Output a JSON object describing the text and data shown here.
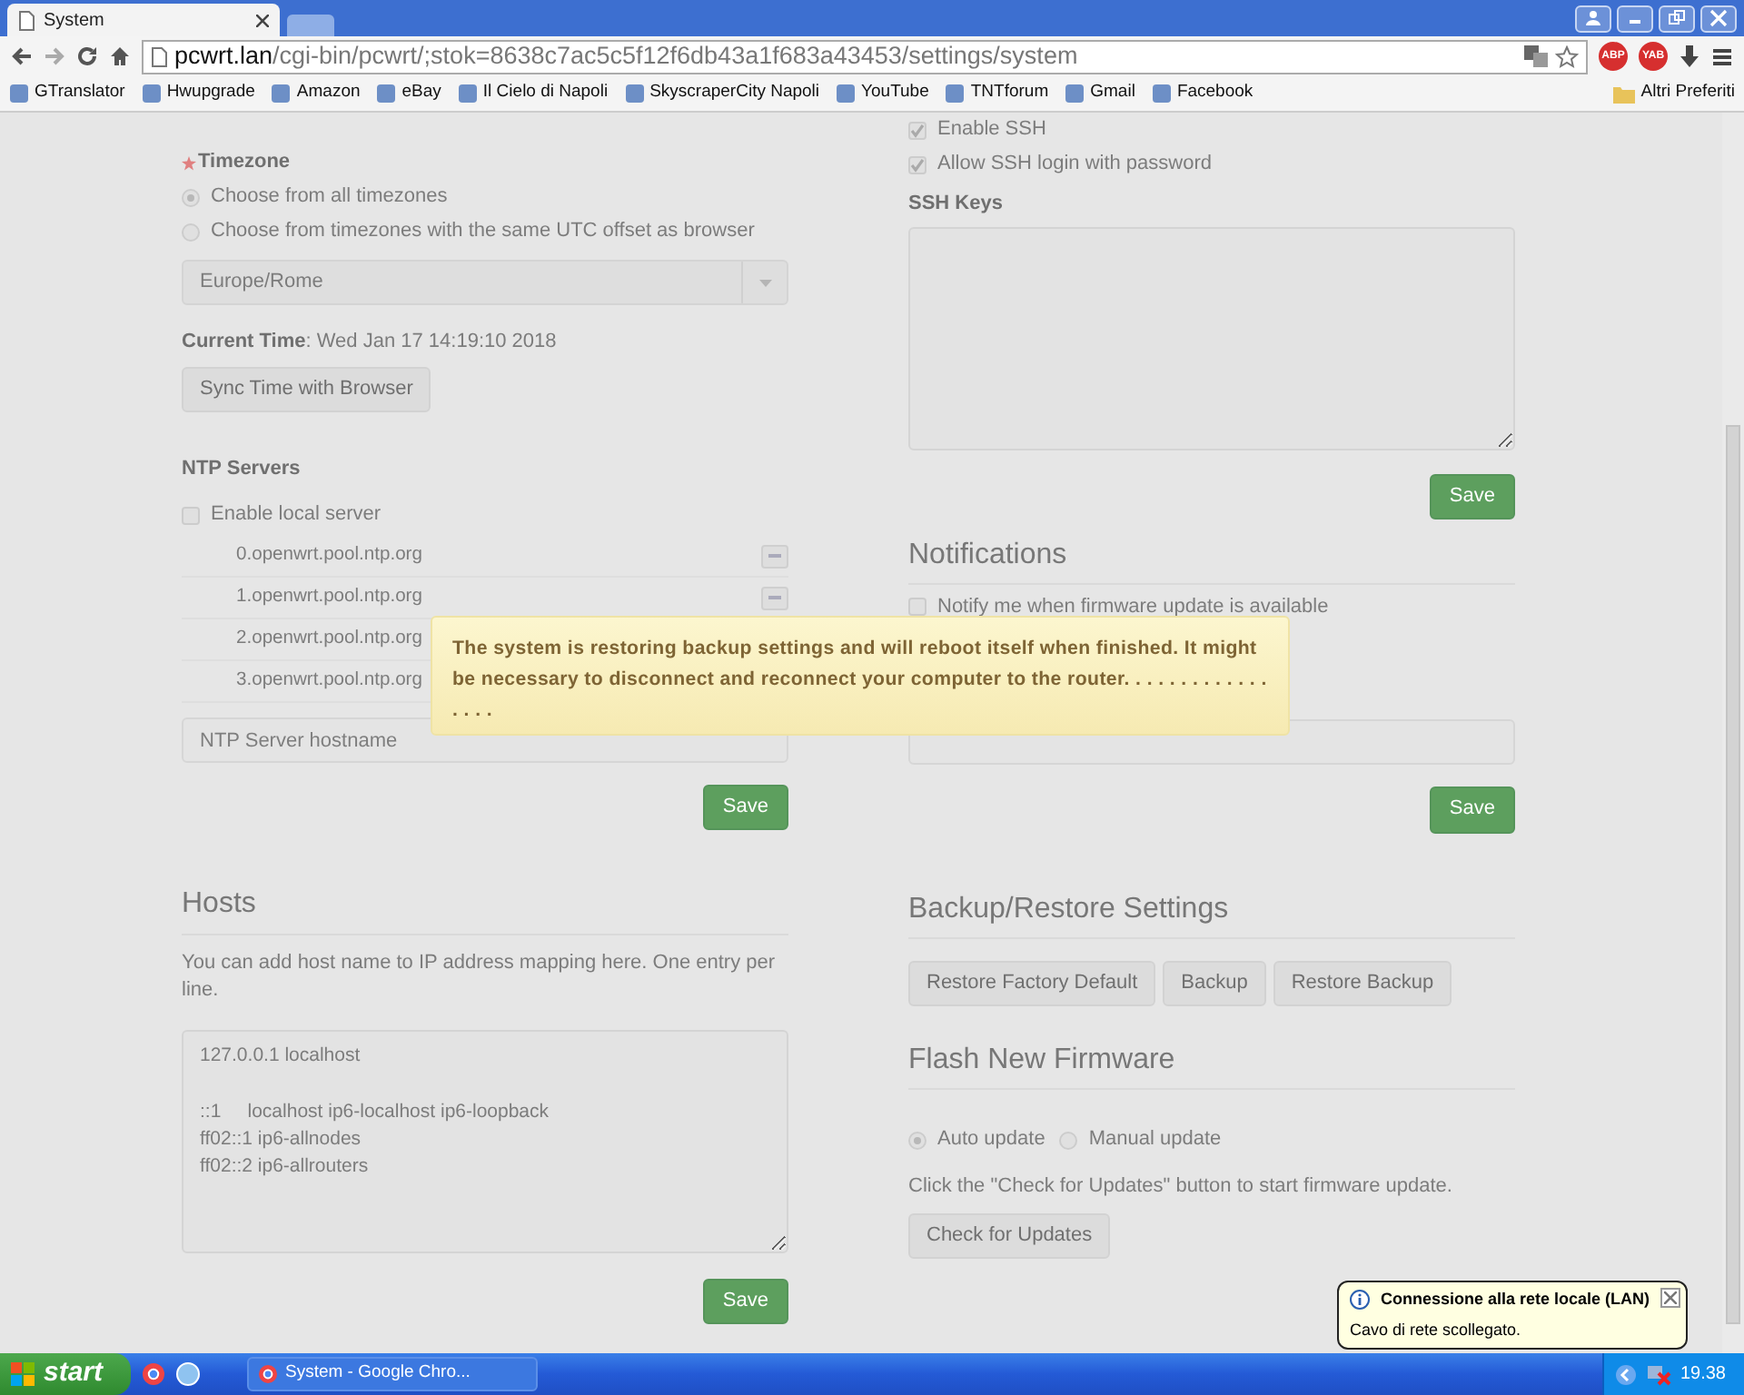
{
  "browser": {
    "tab": {
      "title": "System",
      "selected": true
    },
    "url": {
      "host": "pcwrt.lan",
      "path": "/cgi-bin/pcwrt/;stok=8638c7ac5c5f12f6db43a1f683a43453/settings/system"
    },
    "extensions": [
      "ABP",
      "YAB"
    ],
    "bookmarks": [
      "GTranslator",
      "Hwupgrade",
      "Amazon",
      "eBay",
      "Il Cielo di Napoli",
      "SkyscraperCity Napoli",
      "YouTube",
      "TNTforum",
      "Gmail",
      "Facebook"
    ],
    "other_bookmarks": "Altri Preferiti"
  },
  "timezone": {
    "label": "Timezone",
    "required": true,
    "options": [
      {
        "label": "Choose from all timezones",
        "selected": true
      },
      {
        "label": "Choose from timezones with the same UTC offset as browser",
        "selected": false
      }
    ],
    "select_value": "Europe/Rome",
    "current_time_label": "Current Time",
    "current_time_value": ": Wed Jan 17 14:19:10 2018",
    "sync_button": "Sync Time with Browser"
  },
  "ntp": {
    "heading": "NTP Servers",
    "local_server": {
      "label": "Enable local server",
      "checked": false
    },
    "servers": [
      {
        "host": "0.openwrt.pool.ntp.org",
        "kind": "removable"
      },
      {
        "host": "1.openwrt.pool.ntp.org",
        "kind": "removable"
      },
      {
        "host": "2.openwrt.pool.ntp.org",
        "kind": "covered"
      },
      {
        "host": "3.openwrt.pool.ntp.org",
        "kind": "covered"
      }
    ],
    "placeholder": "NTP Server hostname",
    "save": "Save"
  },
  "hosts": {
    "heading": "Hosts",
    "help": "You can add host name to IP address mapping here. One entry per line.",
    "value": "127.0.0.1 localhost\n\n::1     localhost ip6-localhost ip6-loopback\nff02::1 ip6-allnodes\nff02::2 ip6-allrouters",
    "save": "Save"
  },
  "ssh": {
    "options": [
      {
        "label": "Enable SSH",
        "checked": true
      },
      {
        "label": "Allow SSH login with password",
        "checked": true
      }
    ],
    "keys_label": "SSH Keys",
    "save": "Save"
  },
  "notifications": {
    "heading": "Notifications",
    "options": [
      {
        "label": "Notify me when firmware update is available",
        "checked": false
      }
    ],
    "save": "Save"
  },
  "backup": {
    "heading": "Backup/Restore Settings",
    "buttons": [
      "Restore Factory Default",
      "Backup",
      "Restore Backup"
    ]
  },
  "firmware": {
    "heading": "Flash New Firmware",
    "options": [
      {
        "label": "Auto update",
        "selected": true
      },
      {
        "label": "Manual update",
        "selected": false
      }
    ],
    "help": "Click the \"Check for Updates\" button to start firmware update.",
    "button": "Check for Updates"
  },
  "notice": "The system is restoring backup settings and will reboot itself when finished. It might be necessary to disconnect and reconnect your computer to the router. . . . . . . . . . . . . . . . .",
  "taskbar": {
    "start": "start",
    "task": "System - Google Chro...",
    "clock": "19.38",
    "balloon": {
      "title": "Connessione alla rete locale (LAN)",
      "body": "Cavo di rete scollegato."
    }
  }
}
